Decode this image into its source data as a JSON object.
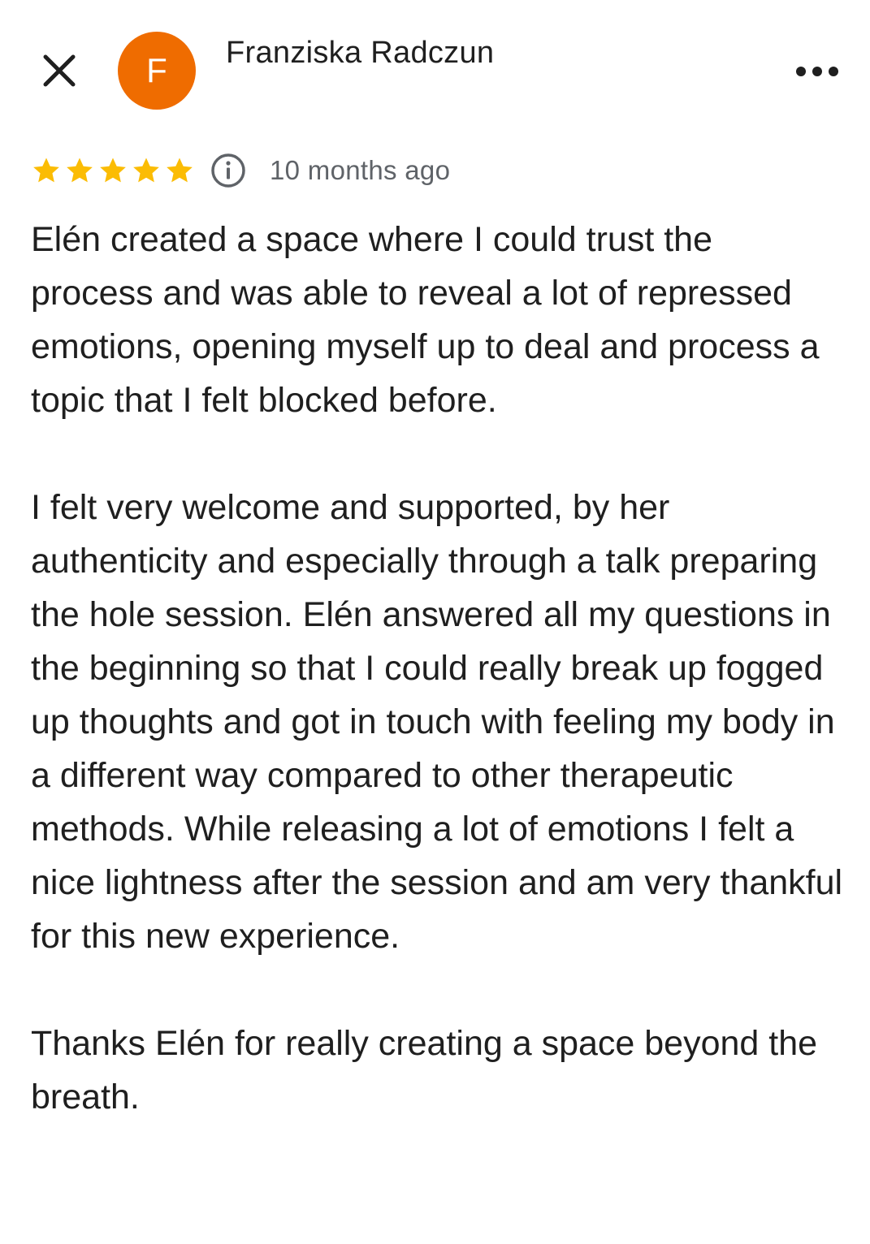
{
  "header": {
    "close_icon": "close-icon",
    "avatar_initial": "F",
    "avatar_color": "#ef6c00",
    "author_name": "Franziska Radczun",
    "more_icon": "more-horizontal-icon"
  },
  "review": {
    "rating": 5,
    "rating_max": 5,
    "star_color": "#fbbc04",
    "info_icon": "info-icon",
    "timestamp": "10 months ago",
    "paragraphs": [
      "Elén created a space where I could trust the process and was able to reveal a lot of repressed emotions, opening myself up to deal and process a topic that I felt blocked before.",
      "I felt very welcome and supported, by her authenticity and especially through a talk preparing the hole session. Elén answered all my questions in the beginning so that I could really break up fogged up thoughts and got in touch with feeling my body in a different way compared to other therapeutic methods. While releasing a lot of emotions I felt a nice lightness after the session and am very thankful for this new experience.",
      "Thanks Elén for really creating a space beyond the breath."
    ]
  }
}
